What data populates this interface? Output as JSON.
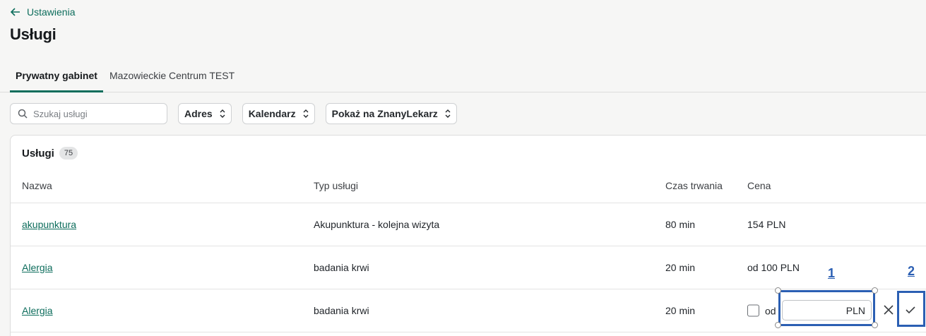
{
  "breadcrumb": {
    "back_label": "Ustawienia"
  },
  "page": {
    "title": "Usługi"
  },
  "tabs": [
    {
      "label": "Prywatny gabinet",
      "active": true
    },
    {
      "label": "Mazowieckie Centrum TEST",
      "active": false
    }
  ],
  "filters": {
    "search_placeholder": "Szukaj usługi",
    "address_label": "Adres",
    "calendar_label": "Kalendarz",
    "show_label": "Pokaż na ZnanyLekarz"
  },
  "services": {
    "title": "Usługi",
    "count": "75",
    "columns": {
      "name": "Nazwa",
      "type": "Typ usługi",
      "duration": "Czas trwania",
      "price": "Cena"
    },
    "rows": [
      {
        "name": "akupunktura",
        "type": "Akupunktura - kolejna wizyta",
        "duration": "80 min",
        "price": "154 PLN"
      },
      {
        "name": "Alergia",
        "type": "badania krwi",
        "duration": "20 min",
        "price": "od 100 PLN"
      },
      {
        "name": "Alergia",
        "type": "badania krwi",
        "duration": "20 min",
        "price": ""
      }
    ],
    "edit": {
      "from_label": "od",
      "price_value": "",
      "currency": "PLN",
      "from_checked": false
    }
  },
  "annotations": {
    "n1": "1",
    "n2": "2"
  },
  "colors": {
    "brand": "#0d6d5c",
    "annotation": "#2b5fb3"
  },
  "icons": [
    "arrow-left-icon",
    "search-icon",
    "chevron-updown-icon",
    "close-icon",
    "check-icon"
  ]
}
